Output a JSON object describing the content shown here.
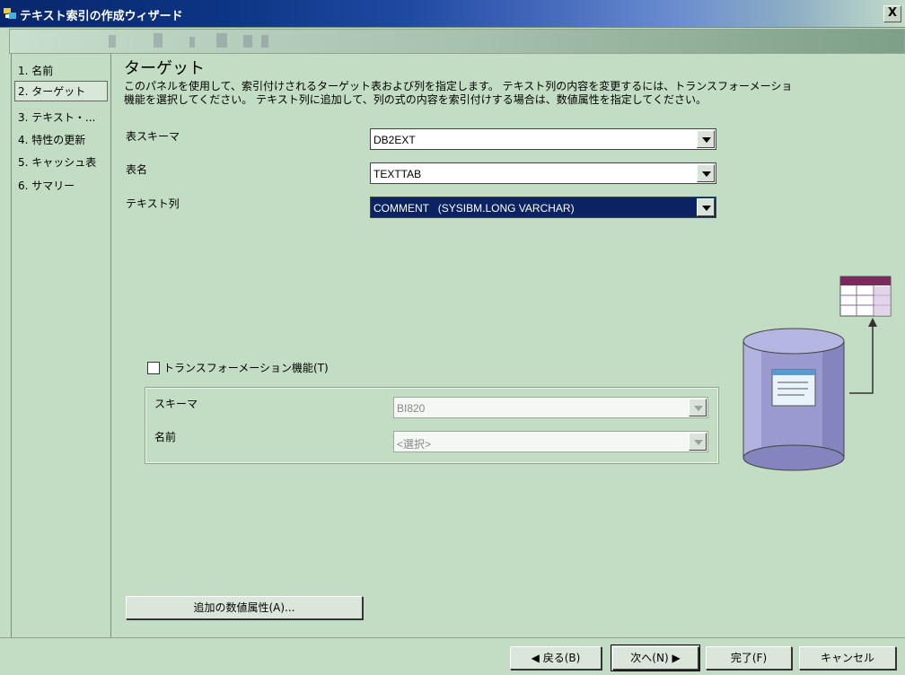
{
  "window": {
    "title": "テキスト索引の作成ウィザード",
    "close_label": "X"
  },
  "steps": [
    {
      "label": "1. 名前",
      "active": false
    },
    {
      "label": "2. ターゲット",
      "active": true
    },
    {
      "label": "3. テキスト・...",
      "active": false
    },
    {
      "label": "4. 特性の更新",
      "active": false
    },
    {
      "label": "5. キャッシュ表",
      "active": false
    },
    {
      "label": "6. サマリー",
      "active": false
    }
  ],
  "main": {
    "heading": "ターゲット",
    "description_line1": "このパネルを使用して、索引付けされるターゲット表および列を指定します。 テキスト列の内容を変更するには、トランスフォーメーショ",
    "description_line2": "機能を選択してください。 テキスト列に追加して、列の式の内容を索引付けする場合は、数値属性を指定してください。",
    "schema_label": "表スキーマ",
    "schema_value": "DB2EXT",
    "table_label": "表名",
    "table_value": "TEXTTAB",
    "column_label": "テキスト列",
    "column_value": "COMMENT   (SYSIBM.LONG VARCHAR)",
    "transform_checkbox_label": "トランスフォーメーション機能(T)",
    "transform_checked": false,
    "transform_schema_label": "スキーマ",
    "transform_schema_value": "BI820",
    "transform_name_label": "名前",
    "transform_name_value": "<選択>",
    "numeric_attr_button": "追加の数値属性(A)..."
  },
  "footer": {
    "back": "◀ 戻る(B)",
    "next": "次へ(N) ▶",
    "finish": "完了(F)",
    "cancel": "キャンセル"
  },
  "colors": {
    "background": "#c3dcc4",
    "selection": "#0b2363",
    "database": "#9a9ad0",
    "table_header": "#7a2b5e"
  },
  "icons": {
    "app": "wizard-icon",
    "illustration": "database-to-table-illustration"
  }
}
